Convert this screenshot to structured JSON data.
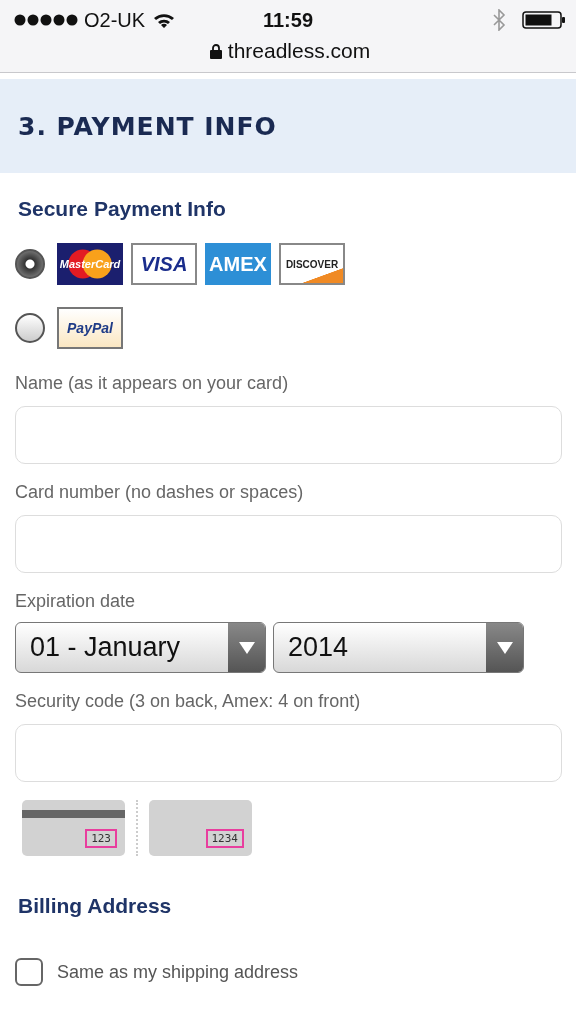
{
  "status_bar": {
    "carrier": "O2-UK",
    "time": "11:59",
    "url": "threadless.com"
  },
  "header": {
    "title": "3. PAYMENT INFO"
  },
  "section_title": "Secure Payment Info",
  "payment_options": [
    {
      "selected": true,
      "logos": [
        {
          "kind": "mastercard",
          "label": "MasterCard"
        },
        {
          "kind": "visa",
          "label": "VISA"
        },
        {
          "kind": "amex",
          "label": "AMEX"
        },
        {
          "kind": "discover",
          "label": "DISCOVER"
        }
      ]
    },
    {
      "selected": false,
      "logos": [
        {
          "kind": "paypal",
          "label": "PayPal"
        }
      ]
    }
  ],
  "fields": [
    {
      "kind": "text",
      "label": "Name (as it appears on your card)"
    },
    {
      "kind": "text",
      "label": "Card number (no dashes or spaces)"
    },
    {
      "kind": "selects",
      "label": "Expiration date",
      "selects": [
        {
          "value": "01 - January"
        },
        {
          "value": "2014"
        }
      ]
    },
    {
      "kind": "text",
      "label": "Security code (3 on back, Amex: 4 on front)"
    }
  ],
  "security_examples": [
    {
      "kind": "back",
      "code": "123"
    },
    {
      "kind": "front",
      "code": "1234"
    }
  ],
  "billing": {
    "title": "Billing Address",
    "same_as_shipping": {
      "label": "Same as my shipping address",
      "checked": false
    }
  }
}
